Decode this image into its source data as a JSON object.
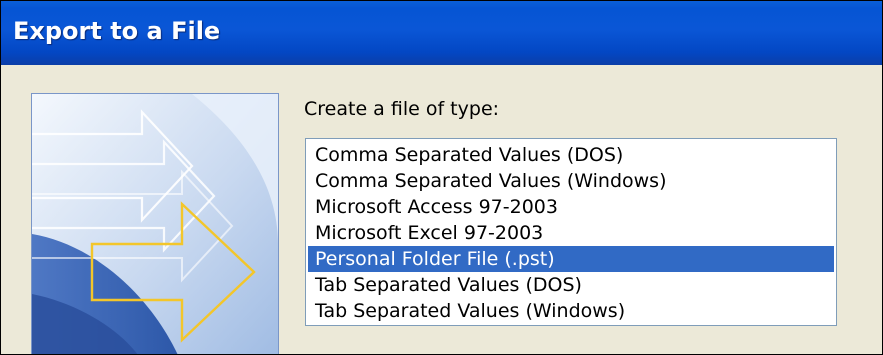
{
  "dialog": {
    "title": "Export to a File",
    "prompt": "Create a file of type:",
    "file_types": [
      "Comma Separated Values (DOS)",
      "Comma Separated Values (Windows)",
      "Microsoft Access 97-2003",
      "Microsoft Excel 97-2003",
      "Personal Folder File (.pst)",
      "Tab Separated Values (DOS)",
      "Tab Separated Values (Windows)"
    ],
    "selected_index": 4
  },
  "colors": {
    "title_bar": "#0a56d6",
    "selection": "#316ac5",
    "dialog_background": "#ece9d8"
  },
  "icons": {
    "banner": "export-arrows-graphic"
  }
}
